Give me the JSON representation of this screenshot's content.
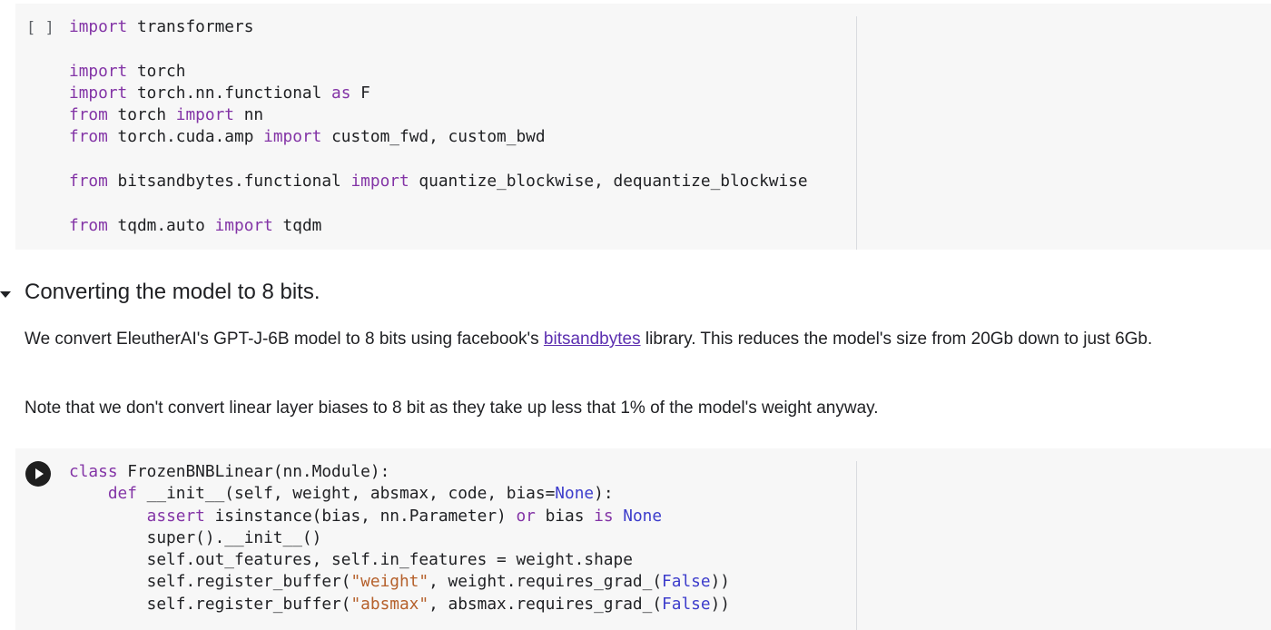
{
  "cell1": {
    "run_indicator": "[ ]",
    "code_lines": [
      "import transformers",
      "",
      "import torch",
      "import torch.nn.functional as F",
      "from torch import nn",
      "from torch.cuda.amp import custom_fwd, custom_bwd",
      "",
      "from bitsandbytes.functional import quantize_blockwise, dequantize_blockwise",
      "",
      "from tqdm.auto import tqdm"
    ]
  },
  "section": {
    "heading": "Converting the model to 8 bits.",
    "para1_before": "We convert EleutherAI's GPT-J-6B model to 8 bits using facebook's ",
    "para1_link": "bitsandbytes",
    "para1_after": " library. This reduces the model's size from 20Gb down to just 6Gb.",
    "para2": "Note that we don't convert linear layer biases to 8 bit as they take up less that 1% of the model's weight anyway."
  },
  "cell2": {
    "code_lines": [
      "class FrozenBNBLinear(nn.Module):",
      "    def __init__(self, weight, absmax, code, bias=None):",
      "        assert isinstance(bias, nn.Parameter) or bias is None",
      "        super().__init__()",
      "        self.out_features, self.in_features = weight.shape",
      "        self.register_buffer(\"weight\", weight.requires_grad_(False))",
      "        self.register_buffer(\"absmax\", absmax.requires_grad_(False))"
    ]
  },
  "colors": {
    "keyword": "#8334a6",
    "string": "#b5602b",
    "builtin": "#3c3ccb",
    "link": "#5c2fb0",
    "cell_background": "#f7f7f7"
  }
}
